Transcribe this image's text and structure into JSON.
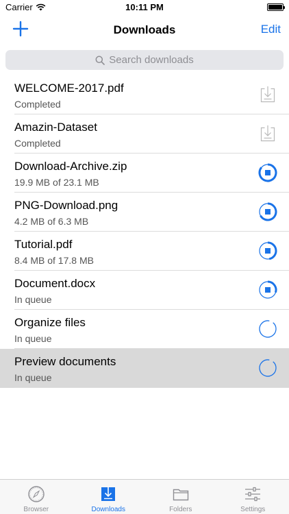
{
  "status_bar": {
    "carrier": "Carrier",
    "time": "10:11 PM"
  },
  "nav": {
    "title": "Downloads",
    "edit_label": "Edit",
    "add_icon": "plus-icon"
  },
  "search": {
    "placeholder": "Search downloads"
  },
  "downloads": [
    {
      "name": "WELCOME-2017.pdf",
      "status": "Completed",
      "state": "completed"
    },
    {
      "name": "Amazin-Dataset",
      "status": "Completed",
      "state": "completed"
    },
    {
      "name": "Download-Archive.zip",
      "status": "19.9 MB of 23.1 MB",
      "state": "downloading",
      "progress": 0.86
    },
    {
      "name": "PNG-Download.png",
      "status": "4.2 MB of 6.3 MB",
      "state": "downloading",
      "progress": 0.67
    },
    {
      "name": "Tutorial.pdf",
      "status": "8.4 MB of 17.8 MB",
      "state": "downloading",
      "progress": 0.47
    },
    {
      "name": "Document.docx",
      "status": "In queue",
      "state": "queued-partial",
      "progress": 0.3
    },
    {
      "name": "Organize files",
      "status": "In queue",
      "state": "queued"
    },
    {
      "name": "Preview documents",
      "status": "In queue",
      "state": "queued",
      "selected": true
    }
  ],
  "tabs": [
    {
      "label": "Browser",
      "icon": "compass-icon",
      "active": false
    },
    {
      "label": "Downloads",
      "icon": "download-icon",
      "active": true
    },
    {
      "label": "Folders",
      "icon": "folder-icon",
      "active": false
    },
    {
      "label": "Settings",
      "icon": "sliders-icon",
      "active": false
    }
  ],
  "colors": {
    "accent": "#1a73e8",
    "gray_icon": "#b9b9b9",
    "selected_row": "#d9d9d9",
    "search_bg": "#e5e6ea"
  }
}
